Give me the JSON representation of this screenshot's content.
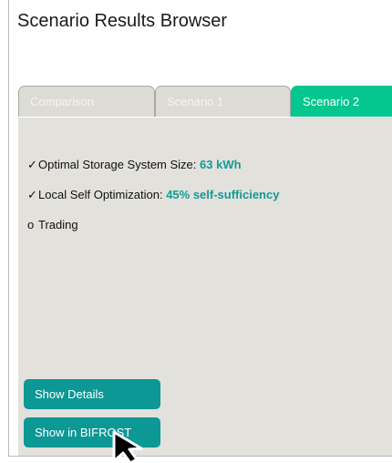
{
  "window": {
    "title": "Scenario Results Browser"
  },
  "tabs": [
    {
      "label": "Comparison",
      "active": false
    },
    {
      "label": "Scenario 1",
      "active": false
    },
    {
      "label": "Scenario 2",
      "active": true
    }
  ],
  "results": [
    {
      "marker": "✓",
      "label": "Optimal Storage System Size: ",
      "value": "63 kWh"
    },
    {
      "marker": "✓",
      "label": "Local Self Optimization: ",
      "value": "45% self-sufficiency"
    },
    {
      "marker": "o",
      "label": "Trading",
      "value": ""
    }
  ],
  "buttons": {
    "show_details": "Show Details",
    "show_in_bifrost": "Show in BIFROST"
  },
  "colors": {
    "active_tab": "#06c68f",
    "button": "#0c9895",
    "highlight_value": "#149b96",
    "panel": "#e2e1dc",
    "inactive_tab": "#dcdbd6"
  },
  "icons": {
    "check": "check-icon",
    "bullet": "circle-icon",
    "cursor": "mouse-pointer-icon"
  }
}
